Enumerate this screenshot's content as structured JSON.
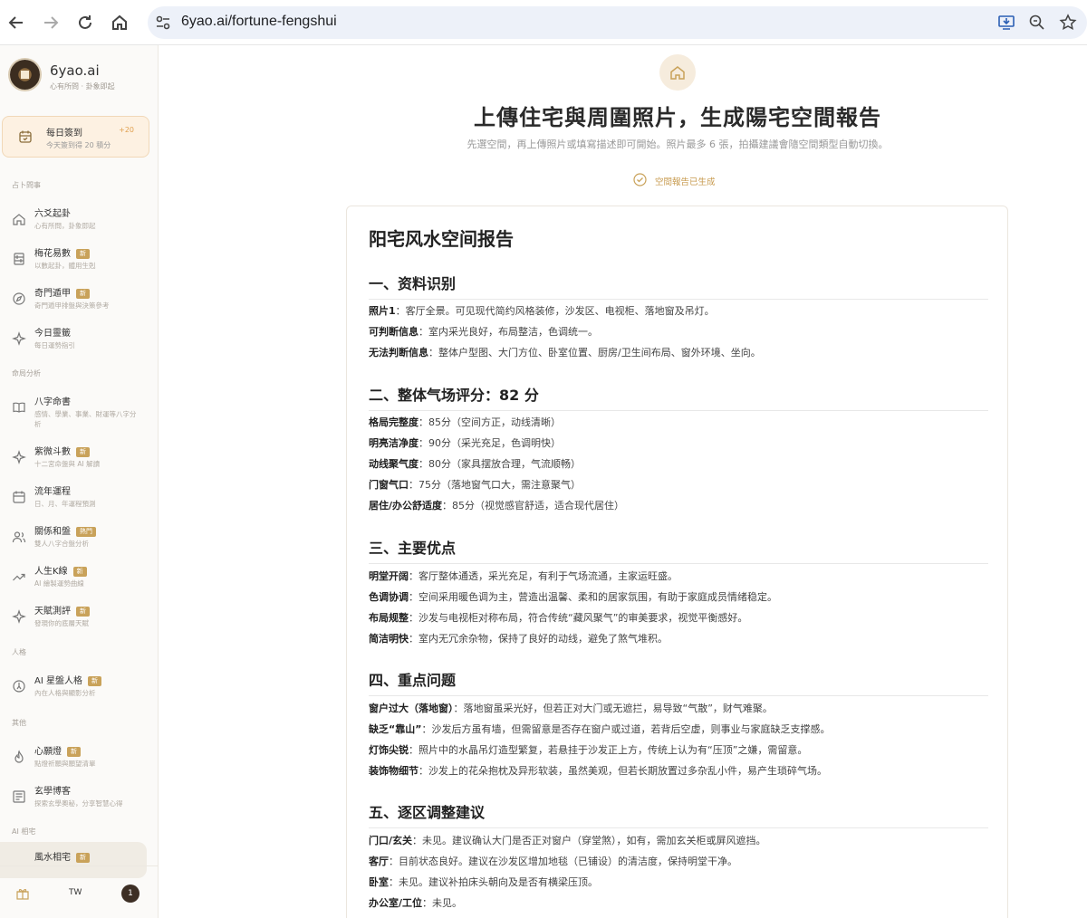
{
  "browser": {
    "url": "6yao.ai/fortune-fengshui"
  },
  "brand": {
    "name": "6yao.ai",
    "tagline": "心有所問 · 卦象即起"
  },
  "checkin": {
    "title": "每日簽到",
    "subtitle": "今天簽到得 20 積分",
    "bonus": "+20"
  },
  "sidebar": {
    "s1": "占卜問事",
    "s2": "命局分析",
    "s3": "人格",
    "s4": "其他",
    "s5": "AI 相宅",
    "items": [
      {
        "label": "六爻起卦",
        "desc": "心有所問，卦象即起",
        "badge": ""
      },
      {
        "label": "梅花易數",
        "desc": "以數起卦，體用生剋",
        "badge": "新"
      },
      {
        "label": "奇門遁甲",
        "desc": "奇門遁甲排盤與決策參考",
        "badge": "新"
      },
      {
        "label": "今日靈籤",
        "desc": "每日運勢指引",
        "badge": ""
      },
      {
        "label": "八字命書",
        "desc": "感情、學業、事業、財運等八字分析",
        "badge": ""
      },
      {
        "label": "紫微斗數",
        "desc": "十二宮命盤與 AI 解讀",
        "badge": "新"
      },
      {
        "label": "流年運程",
        "desc": "日、月、年運程預測",
        "badge": ""
      },
      {
        "label": "關係和盤",
        "desc": "雙人八字合盤分析",
        "badge": "熱門"
      },
      {
        "label": "人生K線",
        "desc": "AI 繪製運勢曲線",
        "badge": "新"
      },
      {
        "label": "天賦測評",
        "desc": "發現你的底層天賦",
        "badge": "新"
      },
      {
        "label": "AI 星盤人格",
        "desc": "內在人格與顯影分析",
        "badge": "新"
      },
      {
        "label": "心願燈",
        "desc": "點燈祈願與願望清單",
        "badge": "新"
      },
      {
        "label": "玄學博客",
        "desc": "探索玄學奧秘，分享智慧心得",
        "badge": ""
      },
      {
        "label": "風水相宅",
        "desc": "",
        "badge": "新"
      }
    ],
    "footer": {
      "lang": "TW",
      "avatar": "1"
    }
  },
  "page": {
    "title": "上傳住宅與周圍照片，生成陽宅空間報告",
    "subtitle": "先選空間，再上傳照片或填寫描述即可開始。照片最多 6 張，拍攝建議會隨空間類型自動切換。",
    "status": "空間報告已生成"
  },
  "report": {
    "title": "阳宅风水空间报告",
    "sections": [
      {
        "heading": "一、资料识别",
        "lines": [
          {
            "k": "照片1",
            "v": "：客厅全景。可见现代简约风格装修，沙发区、电视柜、落地窗及吊灯。"
          },
          {
            "k": "可判断信息",
            "v": "：室内采光良好，布局整洁，色调统一。"
          },
          {
            "k": "无法判断信息",
            "v": "：整体户型图、大门方位、卧室位置、厨房/卫生间布局、窗外环境、坐向。"
          }
        ]
      },
      {
        "heading": "二、整体气场评分：82 分",
        "lines": [
          {
            "k": "格局完整度",
            "v": "：85分（空间方正，动线清晰）"
          },
          {
            "k": "明亮洁净度",
            "v": "：90分（采光充足，色调明快）"
          },
          {
            "k": "动线聚气度",
            "v": "：80分（家具摆放合理，气流顺畅）"
          },
          {
            "k": "门窗气口",
            "v": "：75分（落地窗气口大，需注意聚气）"
          },
          {
            "k": "居住/办公舒适度",
            "v": "：85分（视觉感官舒适，适合现代居住）"
          }
        ]
      },
      {
        "heading": "三、主要优点",
        "lines": [
          {
            "k": "明堂开阔",
            "v": "：客厅整体通透，采光充足，有利于气场流通，主家运旺盛。"
          },
          {
            "k": "色调协调",
            "v": "：空间采用暖色调为主，营造出温馨、柔和的居家氛围，有助于家庭成员情绪稳定。"
          },
          {
            "k": "布局规整",
            "v": "：沙发与电视柜对称布局，符合传统“藏风聚气”的审美要求，视觉平衡感好。"
          },
          {
            "k": "简洁明快",
            "v": "：室内无冗余杂物，保持了良好的动线，避免了煞气堆积。"
          }
        ]
      },
      {
        "heading": "四、重点问题",
        "lines": [
          {
            "k": "窗户过大（落地窗）",
            "v": "：落地窗虽采光好，但若正对大门或无遮拦，易导致“气散”，财气难聚。"
          },
          {
            "k": "缺乏“靠山”",
            "v": "：沙发后方虽有墙，但需留意是否存在窗户或过道，若背后空虚，则事业与家庭缺乏支撑感。"
          },
          {
            "k": "灯饰尖锐",
            "v": "：照片中的水晶吊灯造型繁复，若悬挂于沙发正上方，传统上认为有“压顶”之嫌，需留意。"
          },
          {
            "k": "装饰物细节",
            "v": "：沙发上的花朵抱枕及异形软装，虽然美观，但若长期放置过多杂乱小件，易产生琐碎气场。"
          }
        ]
      },
      {
        "heading": "五、逐区调整建议",
        "lines": [
          {
            "k": "门口/玄关",
            "v": "：未见。建议确认大门是否正对窗户（穿堂煞），如有，需加玄关柜或屏风遮挡。"
          },
          {
            "k": "客厅",
            "v": "：目前状态良好。建议在沙发区增加地毯（已铺设）的清洁度，保持明堂干净。"
          },
          {
            "k": "卧室",
            "v": "：未见。建议补拍床头朝向及是否有横梁压顶。"
          },
          {
            "k": "办公室/工位",
            "v": "：未见。"
          }
        ]
      }
    ]
  }
}
